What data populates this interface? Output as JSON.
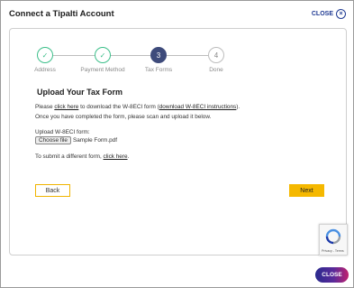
{
  "modal": {
    "title": "Connect a Tipalti Account",
    "close_label": "CLOSE",
    "close_icon": "x-circle-icon",
    "close_bottom_label": "CLOSE"
  },
  "stepper": {
    "steps": [
      {
        "label": "Address",
        "state": "done",
        "glyph": "✓"
      },
      {
        "label": "Payment Method",
        "state": "done",
        "glyph": "✓"
      },
      {
        "label": "Tax Forms",
        "state": "active",
        "glyph": "3"
      },
      {
        "label": "Done",
        "state": "pending",
        "glyph": "4"
      }
    ]
  },
  "form": {
    "heading": "Upload Your Tax Form",
    "line1_pre": "Please ",
    "line1_link1": "click here",
    "line1_mid": " to download the W-8ECI form (",
    "line1_link2": "download W-8ECI instructions",
    "line1_post": ").",
    "line2": "Once you have completed the form, please scan and upload it below.",
    "upload_label": "Upload W-8ECI form:",
    "choose_file_label": "Choose file",
    "file_name": "Sample Form.pdf",
    "different_pre": "To submit a different form, ",
    "different_link": "click here",
    "different_post": "."
  },
  "buttons": {
    "back": "Back",
    "next": "Next"
  },
  "recaptcha": {
    "terms": "Privacy - Terms"
  },
  "colors": {
    "done": "#3cbf8a",
    "active": "#3e4b7b",
    "accent": "#f5b800",
    "close_link": "#1f3a93"
  }
}
